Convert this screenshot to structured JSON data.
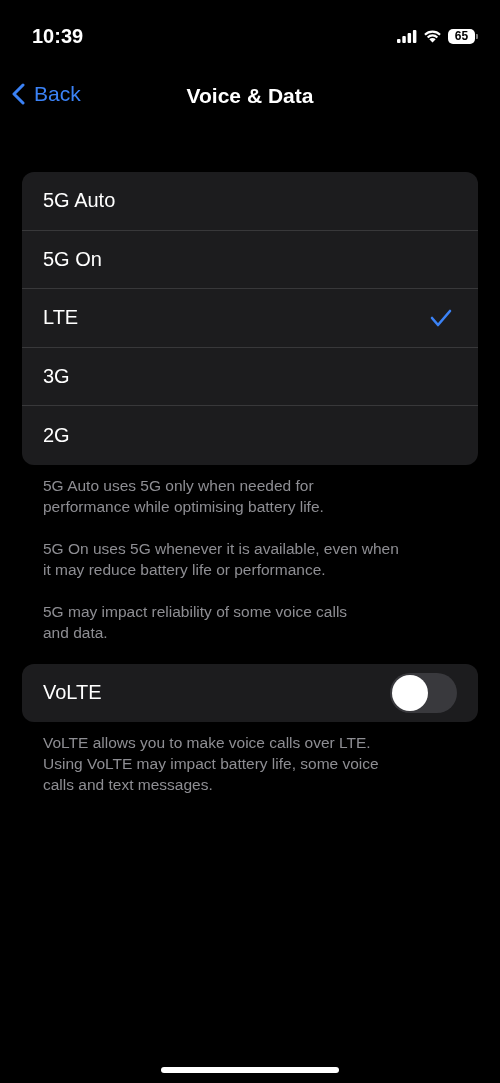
{
  "status_bar": {
    "time": "10:39",
    "battery": "65"
  },
  "nav": {
    "back": "Back",
    "title": "Voice & Data"
  },
  "options": [
    {
      "label": "5G Auto",
      "selected": false
    },
    {
      "label": "5G On",
      "selected": false
    },
    {
      "label": "LTE",
      "selected": true
    },
    {
      "label": "3G",
      "selected": false
    },
    {
      "label": "2G",
      "selected": false
    }
  ],
  "options_notes": [
    "5G Auto uses 5G only when needed for\nperformance while optimising battery life.",
    "5G On uses 5G whenever it is available, even when\nit may reduce battery life or performance.",
    "5G may impact reliability of some voice calls\nand data."
  ],
  "volte": {
    "label": "VoLTE",
    "on": false
  },
  "volte_note": "VoLTE allows you to make voice calls over LTE.\nUsing VoLTE may impact battery life, some voice\ncalls and text messages."
}
